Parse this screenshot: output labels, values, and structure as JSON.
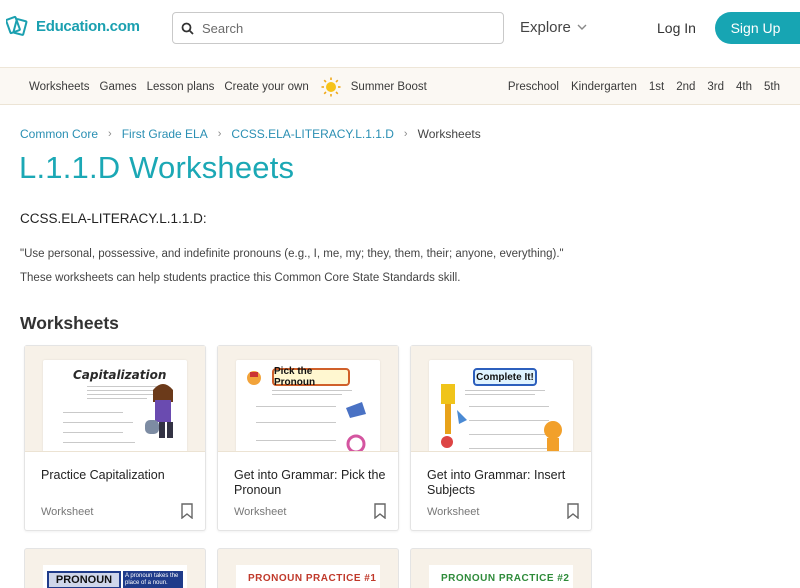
{
  "header": {
    "logo_text": "Education.com",
    "search_placeholder": "Search",
    "explore_label": "Explore",
    "login_label": "Log In",
    "signup_label": "Sign Up"
  },
  "nav": {
    "left": [
      "Worksheets",
      "Games",
      "Lesson plans",
      "Create your own"
    ],
    "summer_label": "Summer Boost",
    "grades": [
      "Preschool",
      "Kindergarten",
      "1st",
      "2nd",
      "3rd",
      "4th",
      "5th"
    ]
  },
  "breadcrumb": [
    "Common Core",
    "First Grade ELA",
    "CCSS.ELA-LITERACY.L.1.1.D",
    "Worksheets"
  ],
  "page": {
    "title": "L.1.1.D Worksheets",
    "standard_code": "CCSS.ELA-LITERACY.L.1.1.D",
    "standard_suffix": ":",
    "quote": "\"Use personal, possessive, and indefinite pronouns (e.g., I, me, my; they, them, their; anyone, everything).\"",
    "description": "These worksheets can help students practice this Common Core State Standards skill.",
    "section_heading": "Worksheets"
  },
  "cards": [
    {
      "name": "Practice Capitalization",
      "kind": "Worksheet",
      "sheet_title": "Capitalization"
    },
    {
      "name": "Get into Grammar: Pick the Pronoun",
      "kind": "Worksheet",
      "sheet_title": "Pick the Pronoun"
    },
    {
      "name": "Get into Grammar: Insert Subjects",
      "kind": "Worksheet",
      "sheet_title": "Complete It!"
    }
  ],
  "cards_row2": [
    {
      "sheet_title": "PRONOUN",
      "sheet_subtitle": "A pronoun takes the place of a noun."
    },
    {
      "sheet_title": "PRONOUN PRACTICE #1"
    },
    {
      "sheet_title": "PRONOUN PRACTICE #2"
    }
  ],
  "colors": {
    "brand": "#17a5b3",
    "link": "#2a8fb3",
    "nav_bg": "#fbf8f3"
  }
}
